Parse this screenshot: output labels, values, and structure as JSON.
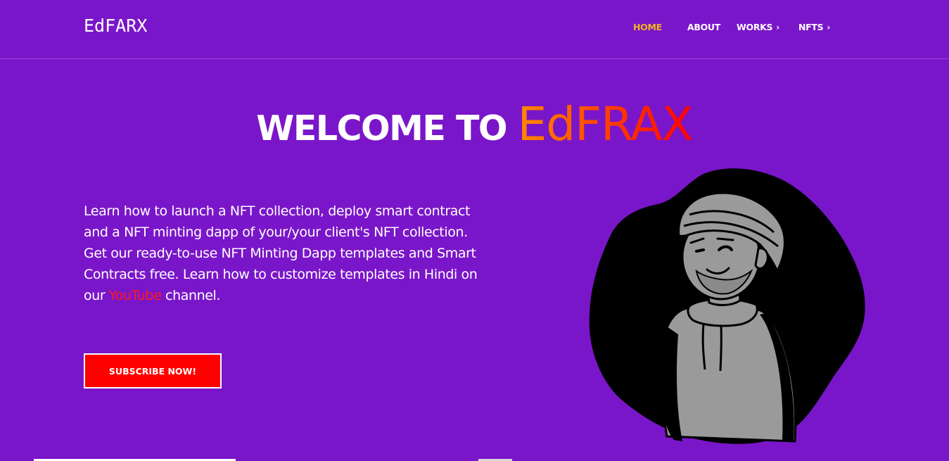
{
  "header": {
    "logo": "EdFARX"
  },
  "nav": {
    "items": [
      {
        "label": "HOME",
        "active": true,
        "has_chevron": false
      },
      {
        "label": "ABOUT",
        "active": false,
        "has_chevron": false
      },
      {
        "label": "WORKS",
        "active": false,
        "has_chevron": true
      },
      {
        "label": "NFTS",
        "active": false,
        "has_chevron": true
      }
    ],
    "chevron": "›"
  },
  "hero": {
    "title_prefix": "WELCOME TO ",
    "title_brand": "EdFRAX",
    "description_before": "Learn how to launch a NFT collection, deploy smart contract and a NFT minting dapp of your/your client's NFT collection. Get our ready-to-use NFT Minting Dapp templates and Smart Contracts free. Learn how to customize templates in Hindi on our ",
    "description_link": "YouTube",
    "description_after": " channel.",
    "subscribe_label": "SUBSCRIBE NOW!"
  },
  "colors": {
    "background": "#7a16c9",
    "nav_active": "#f5b41b",
    "button": "#ff0000",
    "link": "#ff1a1a",
    "brand_gradient": [
      "#ff8a00",
      "#ff0000"
    ],
    "blob": "#000000",
    "figure": "#9a9a9a"
  },
  "icons": {
    "nav_chevron": "chevron-right-icon",
    "illustration": "nft-avatar-illustration"
  }
}
